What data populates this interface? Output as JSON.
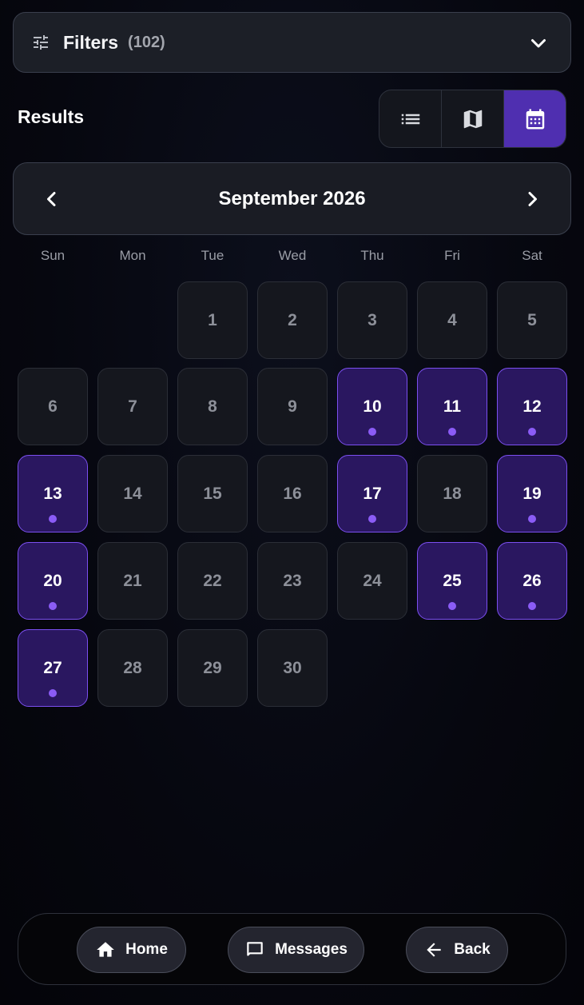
{
  "filters": {
    "label": "Filters",
    "count": "(102)"
  },
  "results": {
    "title": "Results"
  },
  "view_toggle": {
    "options": [
      "list-icon",
      "map-icon",
      "calendar-icon"
    ],
    "active": "calendar-icon"
  },
  "calendar": {
    "month_title": "September 2026",
    "weekdays": [
      "Sun",
      "Mon",
      "Tue",
      "Wed",
      "Thu",
      "Fri",
      "Sat"
    ],
    "days": [
      {
        "d": "1",
        "event": false
      },
      {
        "d": "2",
        "event": false
      },
      {
        "d": "3",
        "event": false
      },
      {
        "d": "4",
        "event": false
      },
      {
        "d": "5",
        "event": false
      },
      {
        "d": "6",
        "event": false
      },
      {
        "d": "7",
        "event": false
      },
      {
        "d": "8",
        "event": false
      },
      {
        "d": "9",
        "event": false
      },
      {
        "d": "10",
        "event": true
      },
      {
        "d": "11",
        "event": true
      },
      {
        "d": "12",
        "event": true
      },
      {
        "d": "13",
        "event": true
      },
      {
        "d": "14",
        "event": false
      },
      {
        "d": "15",
        "event": false
      },
      {
        "d": "16",
        "event": false
      },
      {
        "d": "17",
        "event": true
      },
      {
        "d": "18",
        "event": false
      },
      {
        "d": "19",
        "event": true
      },
      {
        "d": "20",
        "event": true
      },
      {
        "d": "21",
        "event": false
      },
      {
        "d": "22",
        "event": false
      },
      {
        "d": "23",
        "event": false
      },
      {
        "d": "24",
        "event": false
      },
      {
        "d": "25",
        "event": true
      },
      {
        "d": "26",
        "event": true
      },
      {
        "d": "27",
        "event": true
      },
      {
        "d": "28",
        "event": false
      },
      {
        "d": "29",
        "event": false
      },
      {
        "d": "30",
        "event": false
      }
    ]
  },
  "bottom_nav": {
    "home": "Home",
    "messages": "Messages",
    "back": "Back"
  },
  "colors": {
    "accent": "#4f2fb0",
    "event_bg": "#2a1760",
    "event_border": "#7b4ff0",
    "dot": "#8b5cf6"
  }
}
